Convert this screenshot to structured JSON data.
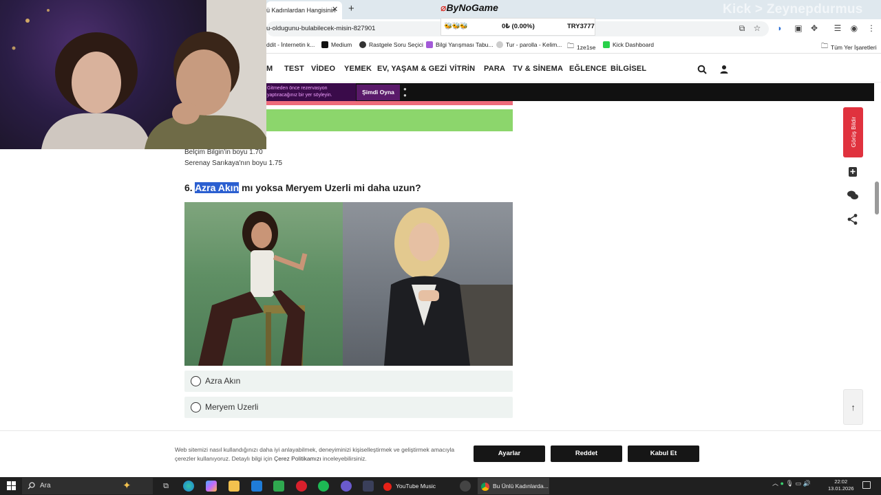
{
  "browser": {
    "tab_title": "ü Kadınlardan Hangisinin",
    "url": "u-oldugunu-bulabilecek-misin-827901",
    "window_overlay_text": "Kick > Zeynepdurmus",
    "bookmarks": [
      {
        "label": "ddit - İnternetin k..."
      },
      {
        "label": "Medium"
      },
      {
        "label": "Rastgele Soru Seçici"
      },
      {
        "label": "Bilgi Yarışması Tabu..."
      },
      {
        "label": "Tur - parolla - Kelim..."
      },
      {
        "label": "1ze1se"
      },
      {
        "label": "Kick Dashboard"
      }
    ],
    "all_bookmarks": "Tüm Yer İşaretleri"
  },
  "bynogame": {
    "logo": "ByNoGame",
    "balance": "0₺ (0.00%)",
    "currency_code": "TRY3777",
    "emotes": "🐝🐝🐝"
  },
  "nav": {
    "items": [
      "M",
      "TEST",
      "VİDEO",
      "YEMEK",
      "EV, YAŞAM & GEZİ",
      "VİTRİN",
      "PARA",
      "TV & SİNEMA",
      "EĞLENCE",
      "BİLGİSEL"
    ]
  },
  "ad": {
    "text_line1": "Gitmeden önce rezervasyon",
    "text_line2": "yaptıracağınız bir yer söyleyin.",
    "cta": "Şimdi Oyna"
  },
  "article": {
    "answer_lines": [
      "Belçim Bilgin'in boyu 1.70",
      "Serenay Sarıkaya'nın boyu 1.75"
    ],
    "question_number": "6.",
    "question_highlight": "Azra Akın",
    "question_rest": "mı yoksa Meryem Uzerli mi daha uzun?",
    "options": [
      "Azra Akın",
      "Meryem Uzerli"
    ]
  },
  "sidebar": {
    "feedback_label": "Görüş Bildir"
  },
  "cookie": {
    "text_part1": "Web sitemizi nasıl kullandığınızı daha iyi anlayabilmek, deneyiminizi kişiselleştirmek ve geliştirmek amacıyla çerezler kullanıyoruz. Detaylı bilgi için",
    "policy_link": "Çerez Politikamızı",
    "text_part2": "inceleyebilirsiniz.",
    "buttons": [
      "Ayarlar",
      "Reddet",
      "Kabul Et"
    ]
  },
  "taskbar": {
    "search_placeholder": "Ara",
    "tasks": [
      "YouTube Music",
      "Bu Ünlü Kadınlarda..."
    ],
    "time": "22:02",
    "date": "13.01.2026"
  }
}
